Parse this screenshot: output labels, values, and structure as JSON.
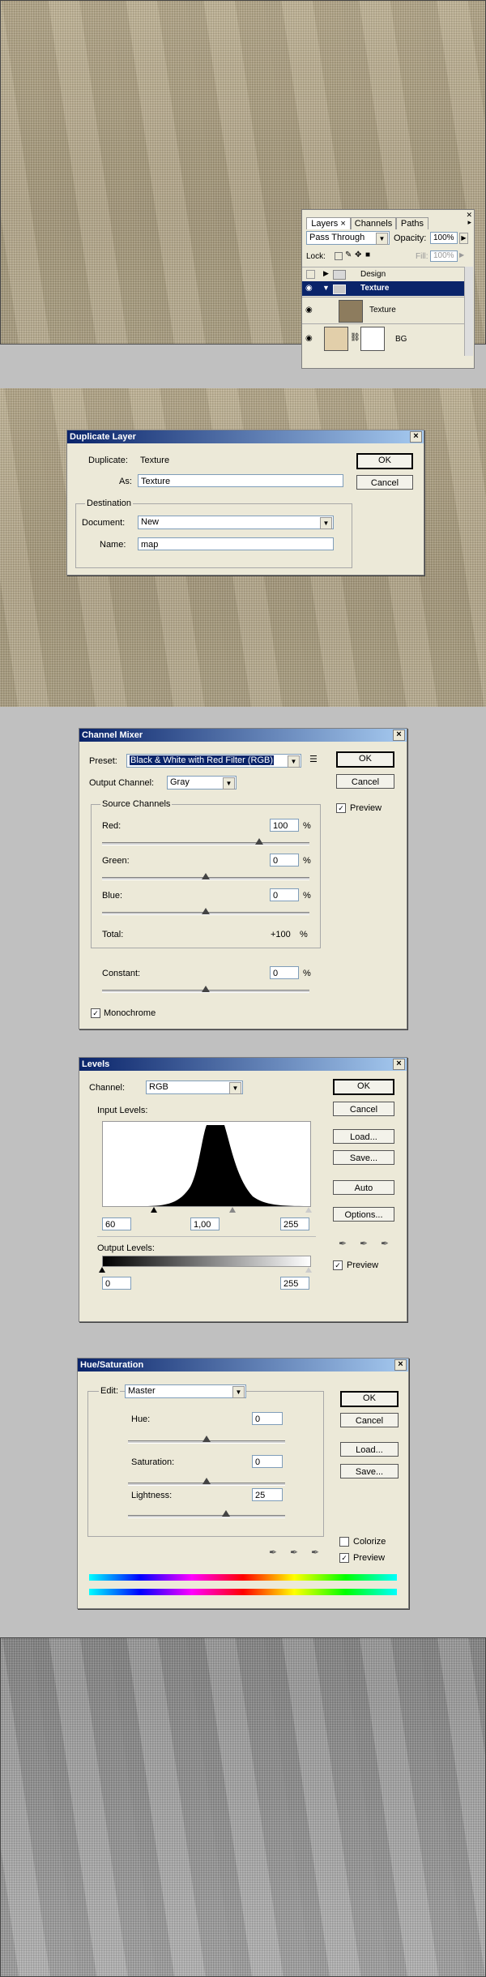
{
  "layers_panel": {
    "tabs": [
      "Layers",
      "Channels",
      "Paths"
    ],
    "tab_close": "×",
    "blend_mode": "Pass Through",
    "opacity_label": "Opacity:",
    "opacity_value": "100%",
    "lock_label": "Lock:",
    "fill_label": "Fill:",
    "fill_value": "100%",
    "layers": [
      {
        "name": "Design",
        "type": "group",
        "visible": false
      },
      {
        "name": "Texture",
        "type": "group",
        "visible": true,
        "selected": true
      },
      {
        "name": "Texture",
        "type": "layer",
        "visible": true
      },
      {
        "name": "BG",
        "type": "layer",
        "visible": true
      }
    ]
  },
  "duplicate_layer": {
    "title": "Duplicate Layer",
    "duplicate_label": "Duplicate:",
    "duplicate_value": "Texture",
    "as_label": "As:",
    "as_value": "Texture",
    "destination_label": "Destination",
    "document_label": "Document:",
    "document_value": "New",
    "name_label": "Name:",
    "name_value": "map",
    "ok": "OK",
    "cancel": "Cancel"
  },
  "channel_mixer": {
    "title": "Channel Mixer",
    "preset_label": "Preset:",
    "preset_value": "Black & White with Red Filter (RGB)",
    "output_label": "Output Channel:",
    "output_value": "Gray",
    "source_label": "Source Channels",
    "red_label": "Red:",
    "red_value": "100",
    "green_label": "Green:",
    "green_value": "0",
    "blue_label": "Blue:",
    "blue_value": "0",
    "total_label": "Total:",
    "total_value": "+100",
    "constant_label": "Constant:",
    "constant_value": "0",
    "percent": "%",
    "monochrome_label": "Monochrome",
    "preview_label": "Preview",
    "ok": "OK",
    "cancel": "Cancel"
  },
  "levels": {
    "title": "Levels",
    "channel_label": "Channel:",
    "channel_value": "RGB",
    "input_label": "Input Levels:",
    "input_black": "60",
    "input_gamma": "1,00",
    "input_white": "255",
    "output_label": "Output Levels:",
    "output_black": "0",
    "output_white": "255",
    "ok": "OK",
    "cancel": "Cancel",
    "load": "Load...",
    "save": "Save...",
    "auto": "Auto",
    "options": "Options...",
    "preview_label": "Preview"
  },
  "hue_saturation": {
    "title": "Hue/Saturation",
    "edit_label": "Edit:",
    "edit_value": "Master",
    "hue_label": "Hue:",
    "hue_value": "0",
    "saturation_label": "Saturation:",
    "saturation_value": "0",
    "lightness_label": "Lightness:",
    "lightness_value": "25",
    "colorize_label": "Colorize",
    "preview_label": "Preview",
    "ok": "OK",
    "cancel": "Cancel",
    "load": "Load...",
    "save": "Save..."
  },
  "colors": {
    "title_bar_start": "#0a246a",
    "title_bar_end": "#a6caf0",
    "dialog_bg": "#ece9d8",
    "selected_layer": "#0a246a"
  }
}
